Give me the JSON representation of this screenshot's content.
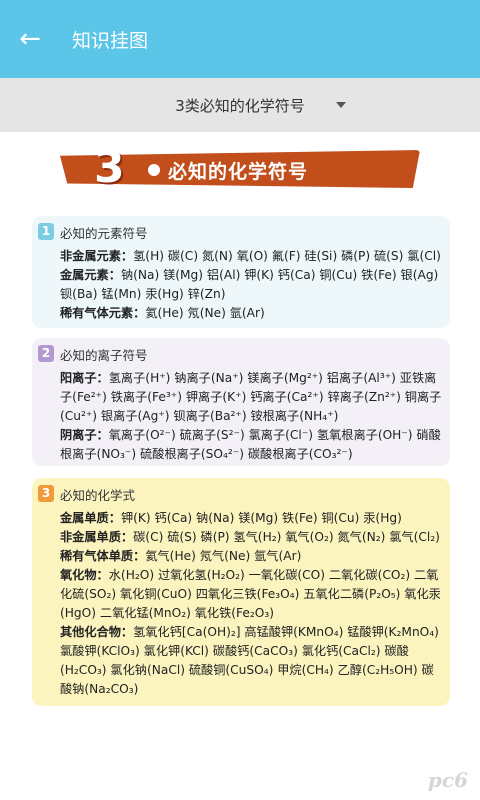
{
  "appbar": {
    "title": "知识挂图",
    "back_icon": "←"
  },
  "selector": {
    "value": "3类必知的化学符号"
  },
  "banner": {
    "number": "3",
    "title": "必知的化学符号"
  },
  "cards": [
    {
      "index": "1",
      "title": "必知的元素符号",
      "lines": [
        {
          "label": "非金属元素：",
          "text": "氢(H) 碳(C) 氮(N) 氧(O) 氟(F) 硅(Si) 磷(P) 硫(S) 氯(Cl)"
        },
        {
          "label": "金属元素：",
          "text": "钠(Na) 镁(Mg) 铝(Al) 钾(K) 钙(Ca) 铜(Cu) 铁(Fe) 银(Ag) 钡(Ba) 锰(Mn) 汞(Hg) 锌(Zn)"
        },
        {
          "label": "稀有气体元素：",
          "text": "氦(He) 氖(Ne) 氩(Ar)"
        }
      ]
    },
    {
      "index": "2",
      "title": "必知的离子符号",
      "lines": [
        {
          "label": "阳离子：",
          "text": "氢离子(H⁺) 钠离子(Na⁺) 镁离子(Mg²⁺) 铝离子(Al³⁺) 亚铁离子(Fe²⁺) 铁离子(Fe³⁺) 钾离子(K⁺) 钙离子(Ca²⁺) 锌离子(Zn²⁺) 铜离子(Cu²⁺) 银离子(Ag⁺) 钡离子(Ba²⁺) 铵根离子(NH₄⁺)"
        },
        {
          "label": "阴离子：",
          "text": "氧离子(O²⁻) 硫离子(S²⁻) 氯离子(Cl⁻) 氢氧根离子(OH⁻) 硝酸根离子(NO₃⁻) 硫酸根离子(SO₄²⁻) 碳酸根离子(CO₃²⁻)"
        }
      ]
    },
    {
      "index": "3",
      "title": "必知的化学式",
      "lines": [
        {
          "label": "金属单质：",
          "text": "钾(K) 钙(Ca) 钠(Na) 镁(Mg) 铁(Fe) 铜(Cu) 汞(Hg)"
        },
        {
          "label": "非金属单质：",
          "text": "碳(C) 硫(S) 磷(P) 氢气(H₂) 氧气(O₂) 氮气(N₂) 氯气(Cl₂)"
        },
        {
          "label": "稀有气体单质：",
          "text": "氦气(He) 氖气(Ne) 氩气(Ar)"
        },
        {
          "label": "氧化物：",
          "text": "水(H₂O) 过氧化氢(H₂O₂) 一氧化碳(CO) 二氧化碳(CO₂) 二氧化硫(SO₂) 氧化铜(CuO) 四氧化三铁(Fe₃O₄) 五氧化二磷(P₂O₅) 氧化汞(HgO) 二氧化锰(MnO₂) 氧化铁(Fe₂O₃)"
        },
        {
          "label": "其他化合物：",
          "text": "氢氧化钙[Ca(OH)₂] 高锰酸钾(KMnO₄) 锰酸钾(K₂MnO₄) 氯酸钾(KClO₃) 氯化钾(KCl) 碳酸钙(CaCO₃) 氯化钙(CaCl₂) 碳酸(H₂CO₃) 氯化钠(NaCl) 硫酸铜(CuSO₄) 甲烷(CH₄) 乙醇(C₂H₅OH) 碳酸钠(Na₂CO₃)"
        }
      ]
    }
  ],
  "watermark": "pc6"
}
